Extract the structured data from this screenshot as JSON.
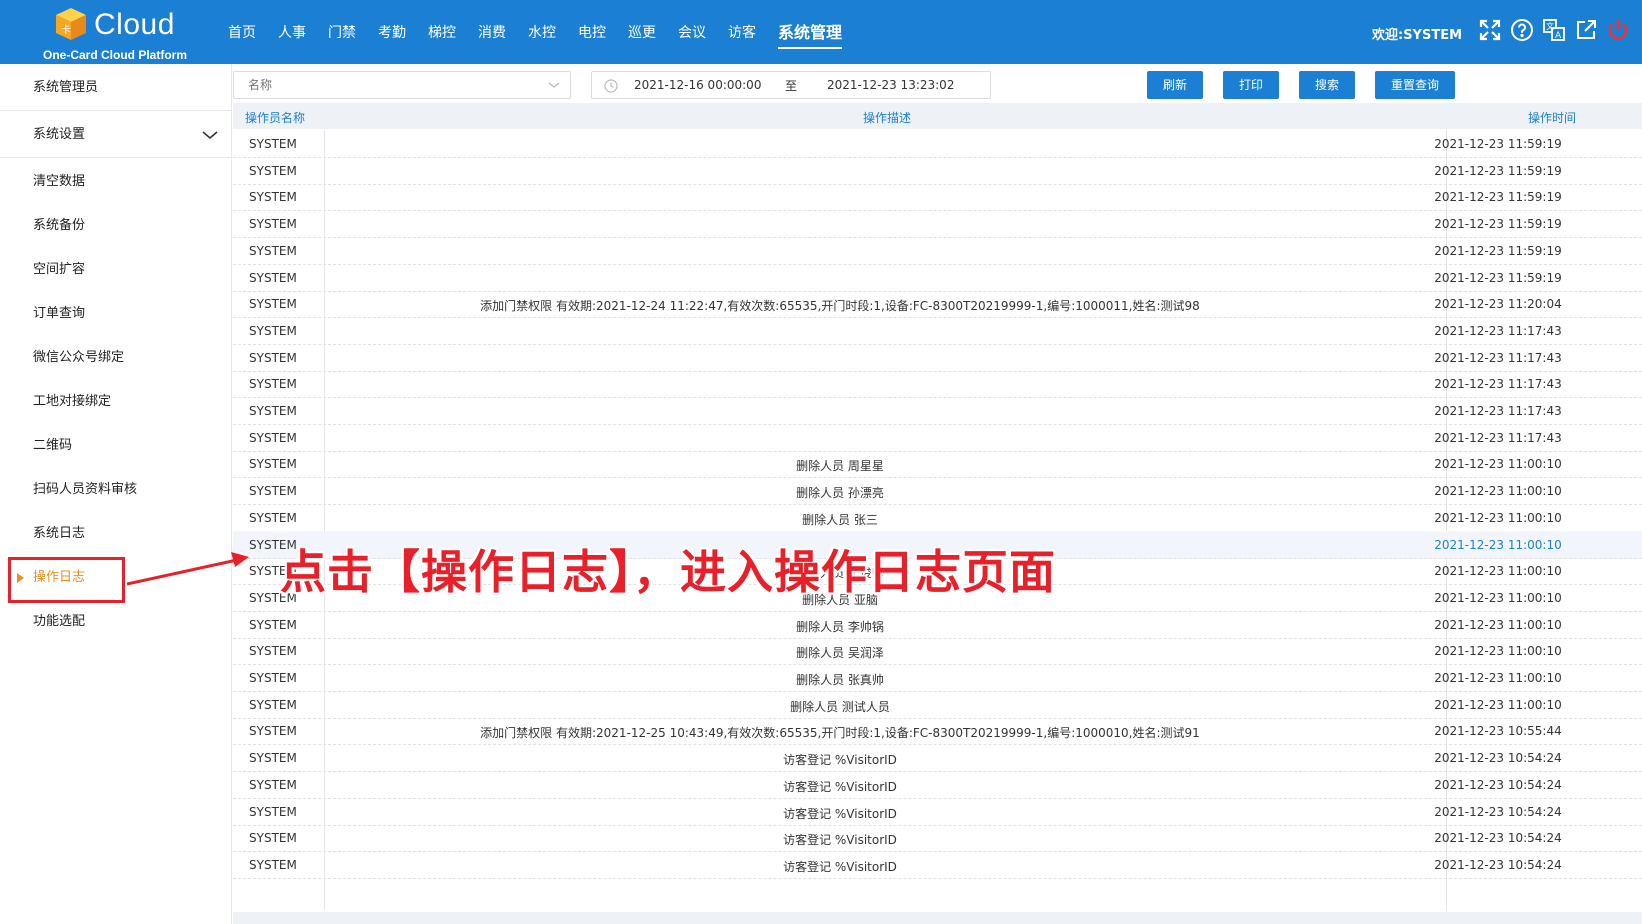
{
  "header": {
    "logo_text": "Cloud",
    "logo_sub": "One-Card Cloud Platform",
    "nav": [
      "首页",
      "人事",
      "门禁",
      "考勤",
      "梯控",
      "消费",
      "水控",
      "电控",
      "巡更",
      "会议",
      "访客",
      "系统管理"
    ],
    "active_nav": "系统管理",
    "welcome": "欢迎:SYSTEM",
    "icons": [
      "fullscreen-icon",
      "help-icon",
      "language-icon",
      "external-link-icon",
      "power-icon"
    ]
  },
  "sidebar": {
    "items": [
      "系统管理员",
      "系统设置",
      "清空数据",
      "系统备份",
      "空间扩容",
      "订单查询",
      "微信公众号绑定",
      "工地对接绑定",
      "二维码",
      "扫码人员资料审核",
      "系统日志",
      "操作日志",
      "功能选配"
    ],
    "active": "操作日志"
  },
  "toolbar": {
    "name_placeholder": "名称",
    "date_start": "2021-12-16 00:00:00",
    "date_sep": "至",
    "date_end": "2021-12-23 13:23:02",
    "refresh": "刷新",
    "print": "打印",
    "search": "搜索",
    "reset": "重置查询"
  },
  "table": {
    "headers": [
      "操作员名称",
      "操作描述",
      "操作时间"
    ],
    "rows": [
      [
        "SYSTEM",
        "",
        "2021-12-23 11:59:19"
      ],
      [
        "SYSTEM",
        "",
        "2021-12-23 11:59:19"
      ],
      [
        "SYSTEM",
        "",
        "2021-12-23 11:59:19"
      ],
      [
        "SYSTEM",
        "",
        "2021-12-23 11:59:19"
      ],
      [
        "SYSTEM",
        "",
        "2021-12-23 11:59:19"
      ],
      [
        "SYSTEM",
        "",
        "2021-12-23 11:59:19"
      ],
      [
        "SYSTEM",
        "添加门禁权限 有效期:2021-12-24 11:22:47,有效次数:65535,开门时段:1,设备:FC-8300T20219999-1,编号:1000011,姓名:测试98",
        "2021-12-23 11:20:04"
      ],
      [
        "SYSTEM",
        "",
        "2021-12-23 11:17:43"
      ],
      [
        "SYSTEM",
        "",
        "2021-12-23 11:17:43"
      ],
      [
        "SYSTEM",
        "",
        "2021-12-23 11:17:43"
      ],
      [
        "SYSTEM",
        "",
        "2021-12-23 11:17:43"
      ],
      [
        "SYSTEM",
        "",
        "2021-12-23 11:17:43"
      ],
      [
        "SYSTEM",
        "删除人员 周星星",
        "2021-12-23 11:00:10"
      ],
      [
        "SYSTEM",
        "删除人员 孙漂亮",
        "2021-12-23 11:00:10"
      ],
      [
        "SYSTEM",
        "删除人员 张三",
        "2021-12-23 11:00:10"
      ],
      [
        "SYSTEM",
        "",
        "2021-12-23 11:00:10"
      ],
      [
        "SYSTEM",
        "删除人员 王俊帅",
        "2021-12-23 11:00:10"
      ],
      [
        "SYSTEM",
        "删除人员 亚脑",
        "2021-12-23 11:00:10"
      ],
      [
        "SYSTEM",
        "删除人员 李帅锅",
        "2021-12-23 11:00:10"
      ],
      [
        "SYSTEM",
        "删除人员 吴润泽",
        "2021-12-23 11:00:10"
      ],
      [
        "SYSTEM",
        "删除人员 张真帅",
        "2021-12-23 11:00:10"
      ],
      [
        "SYSTEM",
        "删除人员 测试人员",
        "2021-12-23 11:00:10"
      ],
      [
        "SYSTEM",
        "添加门禁权限 有效期:2021-12-25 10:43:49,有效次数:65535,开门时段:1,设备:FC-8300T20219999-1,编号:1000010,姓名:测试91",
        "2021-12-23 10:55:44"
      ],
      [
        "SYSTEM",
        "访客登记 %VisitorID",
        "2021-12-23 10:54:24"
      ],
      [
        "SYSTEM",
        "访客登记 %VisitorID",
        "2021-12-23 10:54:24"
      ],
      [
        "SYSTEM",
        "访客登记 %VisitorID",
        "2021-12-23 10:54:24"
      ],
      [
        "SYSTEM",
        "访客登记 %VisitorID",
        "2021-12-23 10:54:24"
      ],
      [
        "SYSTEM",
        "访客登记 %VisitorID",
        "2021-12-23 10:54:24"
      ]
    ],
    "hover_row": 15
  },
  "annotation": {
    "text": "点击【操作日志】，进入操作日志页面"
  },
  "colors": {
    "header_bg": "#1b7fd4",
    "accent": "#1b7fd4",
    "active_side": "#f08c1e",
    "annotation": "#e8202a"
  }
}
